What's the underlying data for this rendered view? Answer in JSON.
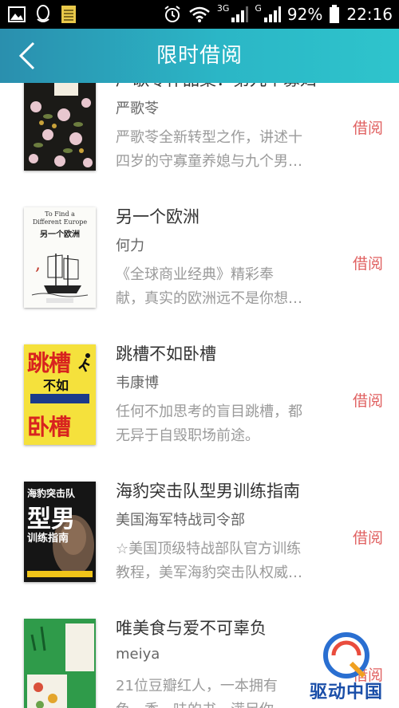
{
  "status_bar": {
    "signal_3g": "3G",
    "signal_g": "G",
    "battery_pct": "92%",
    "time": "22:16",
    "icons": [
      "gallery-icon",
      "qq-icon",
      "notes-icon",
      "alarm-icon",
      "wifi-icon",
      "signal-icon",
      "signal-icon",
      "battery-icon"
    ]
  },
  "header": {
    "title": "限时借阅",
    "back_icon": "chevron-left-icon",
    "bg_color": "#2bb6c6"
  },
  "borrow_color": "#e06060",
  "books": [
    {
      "title": "严歌苓作品集：第九个寡妇",
      "author": "严歌苓",
      "desc_line1": "严歌苓全新转型之作，讲述十",
      "desc_line2": "四岁的守寡童养媳与九个男…",
      "action": "借阅"
    },
    {
      "title": "另一个欧洲",
      "author": "何力",
      "desc_line1": "《全球商业经典》精彩奉",
      "desc_line2": "献，真实的欧洲远不是你想…",
      "action": "借阅",
      "cover_en_1": "To Find a",
      "cover_en_2": "Different Europe",
      "cover_cn": "另一个欧洲"
    },
    {
      "title": "跳槽不如卧槽",
      "author": "韦康博",
      "desc_line1": "任何不加思考的盲目跳槽，都",
      "desc_line2": "无异于自毁职场前途。",
      "action": "借阅",
      "cover_top": "跳槽",
      "cover_mid": "不如",
      "cover_bottom": "卧槽"
    },
    {
      "title": "海豹突击队型男训练指南",
      "author": "美国海军特战司令部",
      "desc_line1": "☆美国顶级特战部队官方训练",
      "desc_line2": "教程，美军海豹突击队权威…",
      "action": "借阅",
      "cover_top": "海豹突击队",
      "cover_mid": "型男",
      "cover_bottom": "训练指南"
    },
    {
      "title": "唯美食与爱不可辜负",
      "author": "meiya",
      "desc_line1": "21位豆瓣红人，一本拥有",
      "desc_line2": "色、香、味的书，满足你…",
      "action": "借阅"
    }
  ],
  "watermark": {
    "text": "驱动中国",
    "logo_icon": "q-logo-icon"
  }
}
